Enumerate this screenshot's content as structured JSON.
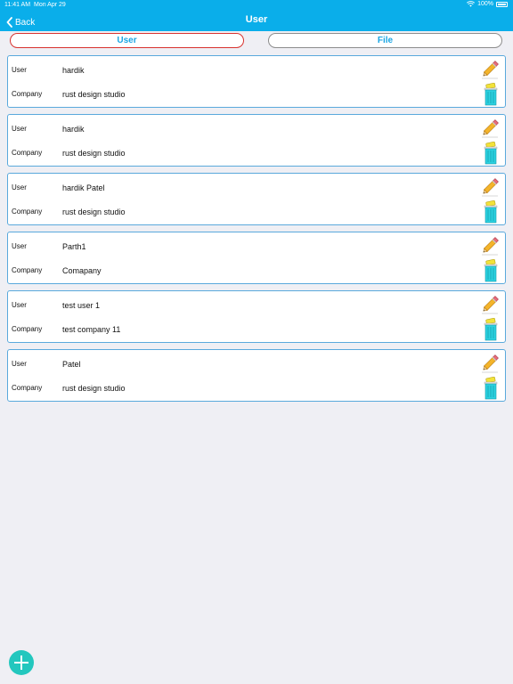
{
  "status_bar": {
    "time": "11:41 AM",
    "date": "Mon Apr 29",
    "battery": "100%"
  },
  "nav": {
    "back_label": "Back",
    "title": "User"
  },
  "segments": {
    "user_label": "User",
    "file_label": "File"
  },
  "field_labels": {
    "user": "User",
    "company": "Company"
  },
  "records": [
    {
      "user": "hardik",
      "company": "rust design studio"
    },
    {
      "user": "hardik",
      "company": "rust design studio"
    },
    {
      "user": "hardik Patel",
      "company": "rust design studio"
    },
    {
      "user": "Parth1",
      "company": "Comapany"
    },
    {
      "user": "test user 1",
      "company": "test company 11"
    },
    {
      "user": "Patel",
      "company": "rust design studio"
    }
  ],
  "icons": {
    "edit": "pencil-icon",
    "delete": "trash-icon",
    "add": "plus-icon",
    "back": "chevron-left-icon"
  },
  "colors": {
    "nav_bg": "#0aaeea",
    "active_segment_border": "#d8322e",
    "inactive_segment_border": "#8c8c8c",
    "card_border": "#5aa9dc",
    "fab": "#23c7be"
  }
}
